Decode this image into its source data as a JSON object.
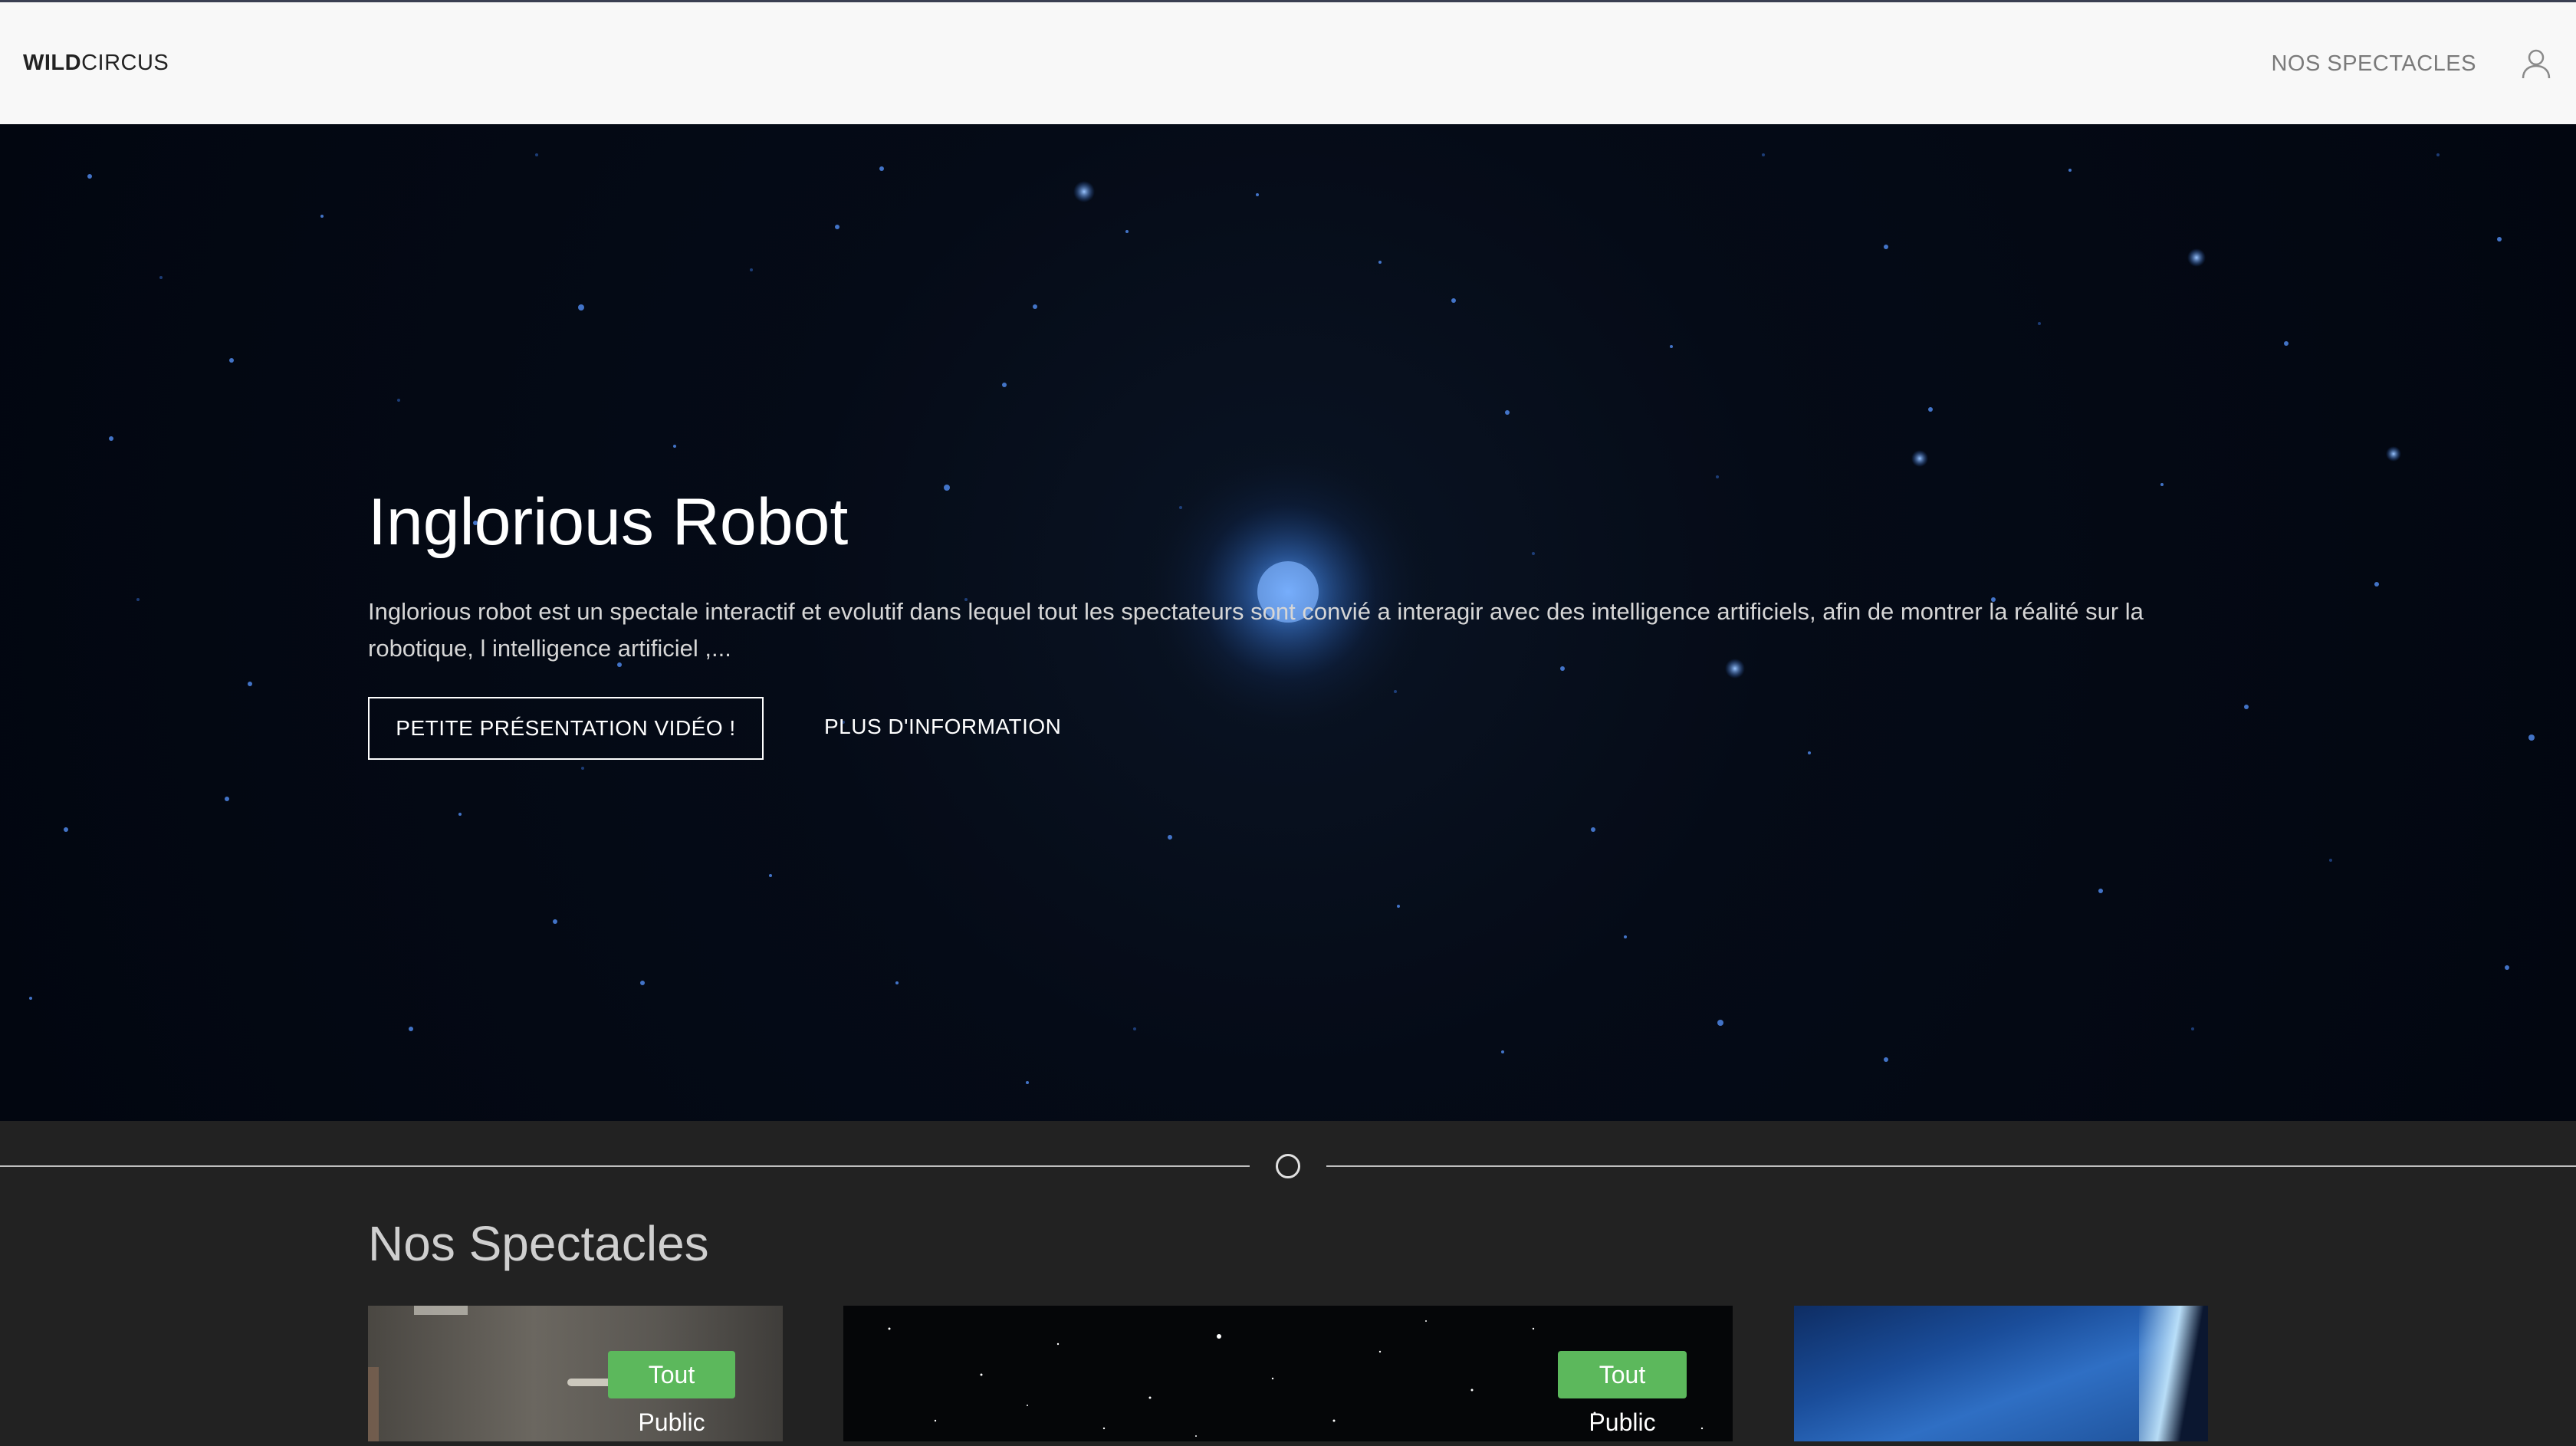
{
  "navbar": {
    "brand_bold": "WILD",
    "brand_rest": "CIRCUS",
    "link_spectacles": "NOS SPECTACLES",
    "user_icon": "user-icon"
  },
  "hero": {
    "title": "Inglorious Robot",
    "description": "Inglorious robot est un spectale interactif et evolutif dans lequel tout les spectateurs sont convié a interagir avec des intelligence artificiels, afin de montrer la réalité sur la robotique, l intelligence artificiel ,...",
    "video_button": "PETITE PRÉSENTATION VIDÉO !",
    "info_link": "PLUS D'INFORMATION",
    "background": "starfield"
  },
  "spectacles": {
    "title": "Nos Spectacles",
    "cards": [
      {
        "badge": "Tout Public"
      },
      {
        "badge": "Tout Public"
      },
      {
        "badge": ""
      }
    ]
  },
  "colors": {
    "navbar_bg": "#f8f8f8",
    "page_bg": "#222222",
    "badge_green": "#5cb85c"
  }
}
